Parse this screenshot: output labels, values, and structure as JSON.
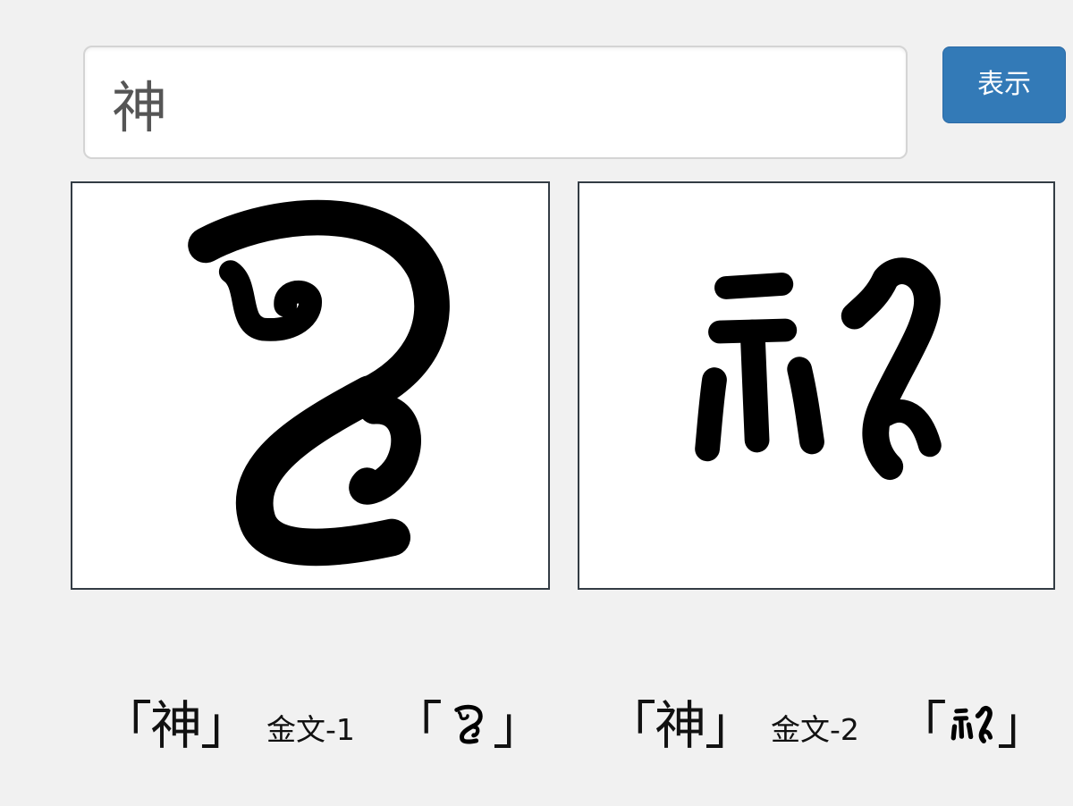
{
  "search": {
    "value": "神"
  },
  "show_button": {
    "label": "表示"
  },
  "panels": [
    {
      "icon": "bronze-script-shen-variant-1-glyph"
    },
    {
      "icon": "bronze-script-shen-variant-2-glyph"
    }
  ],
  "captions": [
    {
      "char": "「神」",
      "label": "金文-1",
      "open_bracket": "「",
      "close_bracket": "」",
      "icon": "bronze-script-shen-variant-1-glyph"
    },
    {
      "char": "「神」",
      "label": "金文-2",
      "open_bracket": "「",
      "close_bracket": "」",
      "icon": "bronze-script-shen-variant-2-glyph"
    }
  ],
  "colors": {
    "background": "#f1f1f1",
    "button": "#337ab7",
    "panel_border": "#333c44",
    "glyph": "#000000"
  }
}
